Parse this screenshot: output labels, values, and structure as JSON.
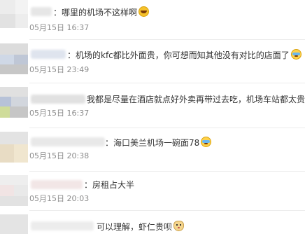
{
  "comments": [
    {
      "text": "：哪里的机场不这样啊",
      "emoji": "laugh-icon",
      "time": "05月15日 16:37"
    },
    {
      "text": "：机场的kfc都比外面贵，你可想而知其他没有对比的店面了",
      "emoji": "cry-icon",
      "time": "05月15日 23:49"
    },
    {
      "text": "我都是尽量在酒店就点好外卖再带过去吃，机场车站都太贵了",
      "emoji": "",
      "time": "05月15日 16:37"
    },
    {
      "text": "：海口美兰机场一碗面78",
      "emoji": "cry-icon",
      "time": "05月15日 20:38"
    },
    {
      "text": "：房租占大半",
      "emoji": "",
      "time": "05月15日 20:03"
    },
    {
      "text": "可以理解，虾仁贵呗",
      "emoji": "cat-face-icon",
      "time": ""
    }
  ]
}
